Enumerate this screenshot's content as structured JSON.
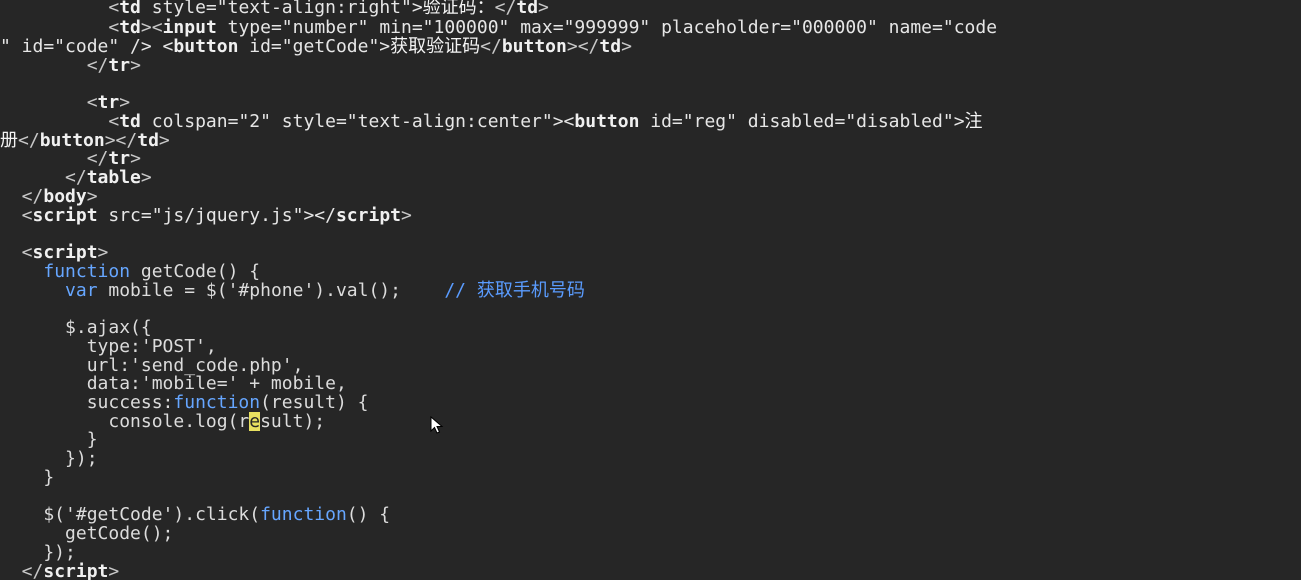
{
  "editor": {
    "background_color": "#262626",
    "lines": [
      [
        "          <",
        "td",
        " style=\"text-align:right\">",
        "验证码：",
        "</",
        "td",
        ">"
      ],
      [
        "          <",
        "td",
        "><",
        "input",
        " type=\"number\" min=\"100000\" max=\"999999\" placeholder=\"000000\" name=\"code"
      ],
      [
        "\" id=\"code\" /> <",
        "button",
        " id=\"getCode\">",
        "获取验证码",
        "</",
        "button",
        "></",
        "td",
        ">"
      ],
      [
        "        </",
        "tr",
        ">"
      ],
      [
        ""
      ],
      [
        "        <",
        "tr",
        ">"
      ],
      [
        "          <",
        "td",
        " colspan=\"2\" style=\"text-align:center\"><",
        "button",
        " id=\"reg\" disabled=\"disabled\">",
        "注"
      ],
      [
        "册",
        "</",
        "button",
        "></",
        "td",
        ">"
      ],
      [
        "        </",
        "tr",
        ">"
      ],
      [
        "      </",
        "table",
        ">"
      ],
      [
        "  </",
        "body",
        ">"
      ],
      [
        "  <",
        "script",
        " src=\"js/jquery.js\"></",
        "script",
        ">"
      ],
      [
        ""
      ],
      [
        "  <",
        "script",
        ">"
      ],
      [
        "    ",
        "function",
        " getCode() {"
      ],
      [
        "      ",
        "var",
        " mobile = $('#phone').val();    ",
        "// 获取手机号码"
      ],
      [
        ""
      ],
      [
        "      $.ajax({"
      ],
      [
        "        type:'POST',"
      ],
      [
        "        url:'send_code.php',"
      ],
      [
        "        data:'mobile=' + mobile,"
      ],
      [
        "        success:",
        "function",
        "(result) {"
      ],
      [
        "          console.log(r",
        "e",
        "sult);"
      ],
      [
        "        }"
      ],
      [
        "      });"
      ],
      [
        "    }"
      ],
      [
        ""
      ],
      [
        "    $('#getCode').click(",
        "function",
        "() {"
      ],
      [
        "      getCode();"
      ],
      [
        "    });"
      ],
      [
        "  </",
        "script",
        ">"
      ]
    ]
  }
}
